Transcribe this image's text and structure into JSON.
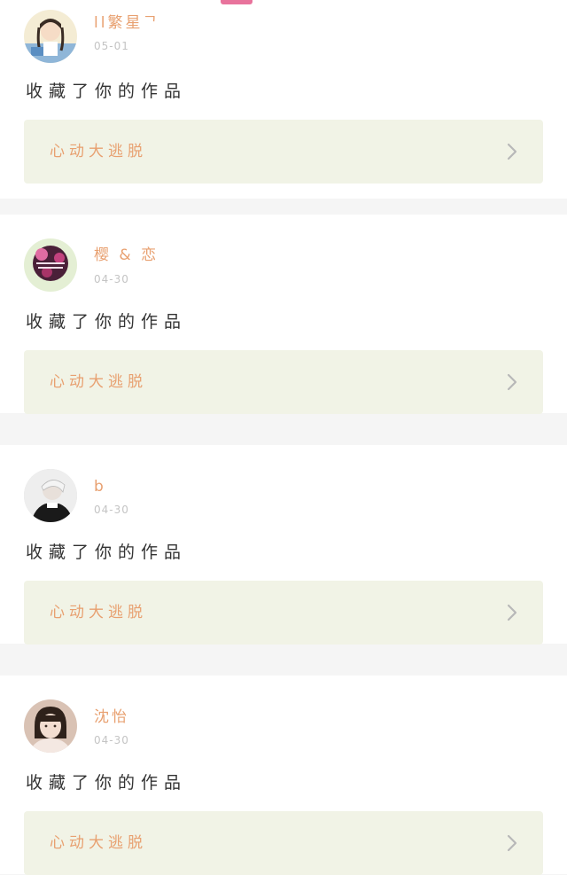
{
  "icons": {
    "chevron": "chevron-right-icon",
    "avatar": "avatar-image"
  },
  "colors": {
    "accent_pink": "#e8739c",
    "name_orange": "#e8a070",
    "date_gray": "#c4c4c4",
    "link_bg": "#f1f3e6",
    "separator": "#f5f5f5"
  },
  "notifications": [
    {
      "username": "ll繁星ᄀ",
      "date": "05-01",
      "action": "收藏了你的作品",
      "work_title": "心动大逃脱"
    },
    {
      "username": "樱 & 恋",
      "date": "04-30",
      "action": "收藏了你的作品",
      "work_title": "心动大逃脱"
    },
    {
      "username": "b",
      "date": "04-30",
      "action": "收藏了你的作品",
      "work_title": "心动大逃脱"
    },
    {
      "username": "沈怡",
      "date": "04-30",
      "action": "收藏了你的作品",
      "work_title": "心动大逃脱"
    }
  ]
}
